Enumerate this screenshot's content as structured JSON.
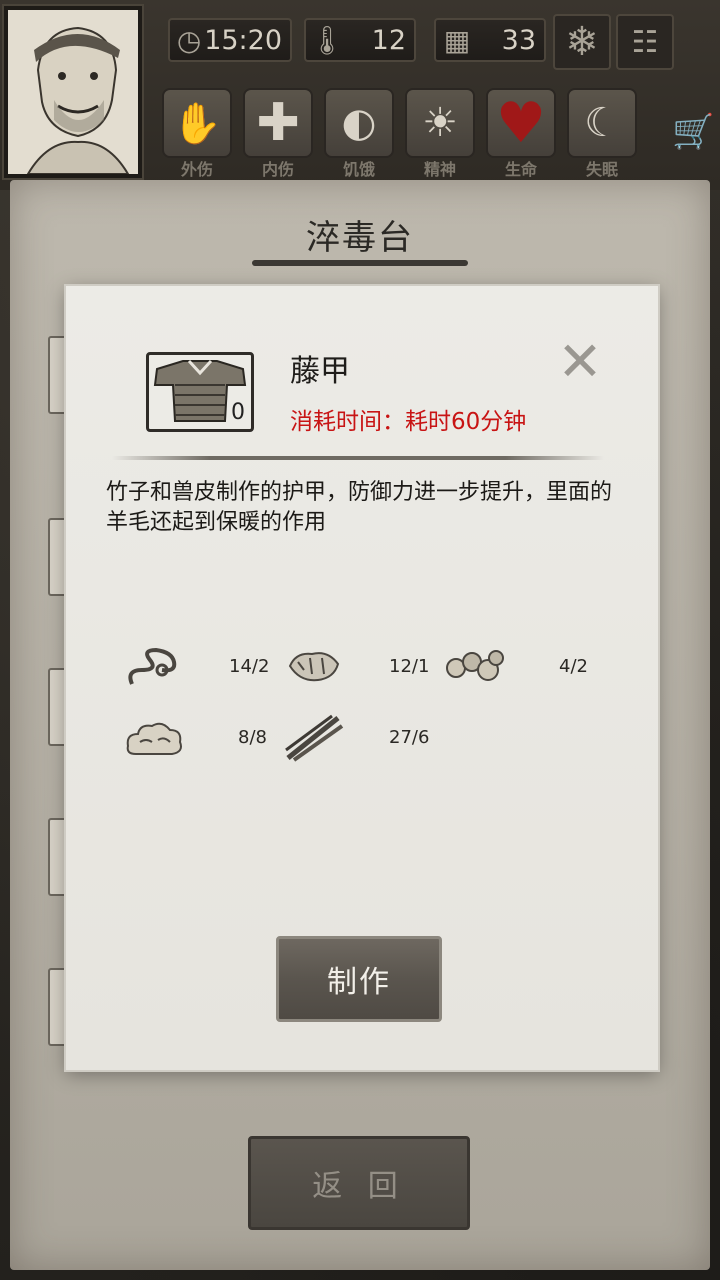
{
  "header": {
    "time": "15:20",
    "temperature": "12",
    "day": "33",
    "weather_icon": "snowflake-icon",
    "status_buttons": [
      {
        "label": "外伤",
        "icon": "hand-icon"
      },
      {
        "label": "内伤",
        "icon": "cross-icon"
      },
      {
        "label": "饥饿",
        "icon": "stomach-icon"
      },
      {
        "label": "精神",
        "icon": "brain-icon"
      },
      {
        "label": "生命",
        "icon": "heart-icon"
      },
      {
        "label": "失眠",
        "icon": "moon-icon"
      }
    ]
  },
  "panel": {
    "title": "淬毒台",
    "back_label": "返 回"
  },
  "dialog": {
    "item_name": "藤甲",
    "item_count": "0",
    "time_cost": "消耗时间：耗时60分钟",
    "description": "竹子和兽皮制作的护甲，防御力进一步提升，里面的羊毛还起到保暖的作用",
    "materials": [
      {
        "icon": "rope-icon",
        "count": "14/2"
      },
      {
        "icon": "animal-hide-icon",
        "count": "12/1"
      },
      {
        "icon": "ore-icon",
        "count": "4/2"
      },
      {
        "icon": "wool-icon",
        "count": "8/8"
      },
      {
        "icon": "bamboo-sticks-icon",
        "count": "27/6"
      }
    ],
    "make_label": "制作"
  },
  "colors": {
    "time_cost": "#c81414",
    "life_heart": "#a01818"
  }
}
